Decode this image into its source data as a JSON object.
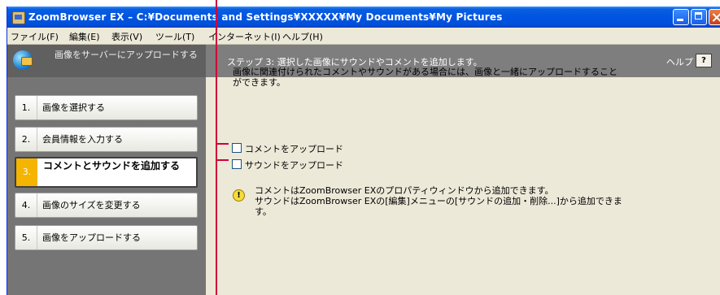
{
  "window": {
    "title": "ZoomBrowser EX  –  C:¥Documents and Settings¥XXXXX¥My Documents¥My Pictures"
  },
  "menu": {
    "items": [
      "ファイル(F)",
      "編集(E)",
      "表示(V)",
      "ツール(T)",
      "インターネット(I)",
      "ヘルプ(H)"
    ]
  },
  "sidebar": {
    "header": "画像をサーバーにアップロードする",
    "steps": [
      {
        "num": "1.",
        "label": "画像を選択する"
      },
      {
        "num": "2.",
        "label": "会員情報を入力する"
      },
      {
        "num": "3.",
        "label": "コメントとサウンドを追加する"
      },
      {
        "num": "4.",
        "label": "画像のサイズを変更する"
      },
      {
        "num": "5.",
        "label": "画像をアップロードする"
      }
    ]
  },
  "main": {
    "step_title": "ステップ 3:  選択した画像にサウンドやコメントを追加します。",
    "help_label": "ヘルプ",
    "help_button": "?",
    "description": "画像に関連付けられたコメントやサウンドがある場合には、画像と一緒にアップロードすることができます。",
    "checkbox_comment": "コメントをアップロード",
    "checkbox_sound": "サウンドをアップロード",
    "info_icon": "!",
    "note_line1": "コメントはZoomBrowser EXのプロパティウィンドウから追加できます。",
    "note_line2": "サウンドはZoomBrowser EXの[編集]メニューの[サウンドの追加・削除...]から追加できます。"
  },
  "colors": {
    "titlebar": "#0054e3",
    "active_step": "#f4b400",
    "callout": "#d0003a"
  }
}
